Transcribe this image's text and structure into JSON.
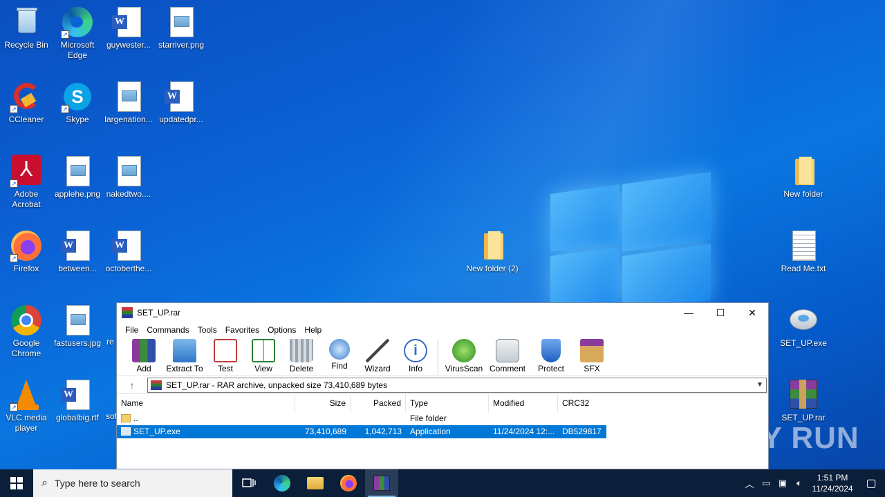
{
  "desktop": {
    "icons_left": [
      {
        "label": "Recycle Bin",
        "kind": "recycle-bin"
      },
      {
        "label": "Microsoft Edge",
        "kind": "edge"
      },
      {
        "label": "guywester...",
        "kind": "word"
      },
      {
        "label": "starriver.png",
        "kind": "image"
      },
      {
        "label": "CCleaner",
        "kind": "ccleaner"
      },
      {
        "label": "Skype",
        "kind": "skype"
      },
      {
        "label": "largenation...",
        "kind": "image"
      },
      {
        "label": "updatedpr...",
        "kind": "word"
      },
      {
        "label": "Adobe Acrobat",
        "kind": "acrobat"
      },
      {
        "label": "applehe.png",
        "kind": "image"
      },
      {
        "label": "nakedtwo....",
        "kind": "image"
      },
      {
        "label": "Firefox",
        "kind": "firefox"
      },
      {
        "label": "between...",
        "kind": "word"
      },
      {
        "label": "octoberthe...",
        "kind": "word"
      },
      {
        "label": "Google Chrome",
        "kind": "chrome"
      },
      {
        "label": "fastusers.jpg",
        "kind": "image"
      },
      {
        "label": "VLC media player",
        "kind": "vlc"
      },
      {
        "label": "globalbig.rtf",
        "kind": "word"
      }
    ],
    "partial_labels": {
      "row5": "re",
      "row6": "sof"
    },
    "middle_folder": "New folder (2)",
    "right_icons": [
      {
        "label": "New folder",
        "kind": "folder"
      },
      {
        "label": "Read Me.txt",
        "kind": "text"
      },
      {
        "label": "SET_UP.exe",
        "kind": "setup"
      },
      {
        "label": "SET_UP.rar",
        "kind": "rar"
      }
    ]
  },
  "winrar": {
    "title": "SET_UP.rar",
    "controls": {
      "minimize": "—",
      "maximize": "☐",
      "close": "✕"
    },
    "menu": [
      "File",
      "Commands",
      "Tools",
      "Favorites",
      "Options",
      "Help"
    ],
    "toolbar": [
      "Add",
      "Extract To",
      "Test",
      "View",
      "Delete",
      "Find",
      "Wizard",
      "Info",
      "VirusScan",
      "Comment",
      "Protect",
      "SFX"
    ],
    "path": "SET_UP.rar - RAR archive, unpacked size 73,410,689 bytes",
    "columns": {
      "name": "Name",
      "size": "Size",
      "packed": "Packed",
      "type": "Type",
      "modified": "Modified",
      "crc": "CRC32"
    },
    "rows": [
      {
        "name": "..",
        "size": "",
        "packed": "",
        "type": "File folder",
        "modified": "",
        "crc": ""
      },
      {
        "name": "SET_UP.exe",
        "size": "73,410,689",
        "packed": "1,042,713",
        "type": "Application",
        "modified": "11/24/2024 12:...",
        "crc": "DB529817"
      }
    ]
  },
  "watermark": "ANY RUN",
  "taskbar": {
    "search_placeholder": "Type here to search",
    "time": "1:51 PM",
    "date": "11/24/2024"
  },
  "colors": {
    "selection": "#0078d7",
    "taskbar": "#0b1f3a",
    "desktop": "#0b63d6"
  }
}
